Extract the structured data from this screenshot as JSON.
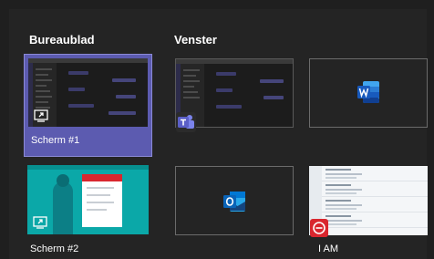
{
  "sections": {
    "desktop_label": "Bureaublad",
    "window_label": "Venster"
  },
  "screens": [
    {
      "caption": "Scherm #1",
      "selected": true,
      "icon": "share-screen-icon"
    },
    {
      "caption": "Scherm #2",
      "selected": false,
      "icon": "share-screen-icon"
    }
  ],
  "windows": [
    {
      "caption": "",
      "app_icon": "teams-icon"
    },
    {
      "caption": "",
      "app_icon": "word-icon"
    },
    {
      "caption": "",
      "app_icon": "outlook-icon"
    },
    {
      "caption": "I AM",
      "app_icon": "i-am-app-icon"
    }
  ],
  "colors": {
    "background": "#242424",
    "selected_tile": "#5c5bb0",
    "teams": "#5b5fc7",
    "word": "#185abd",
    "outlook": "#0a64b8",
    "i_am_red": "#d9262e",
    "screen2_teal": "#0ba8a8"
  }
}
